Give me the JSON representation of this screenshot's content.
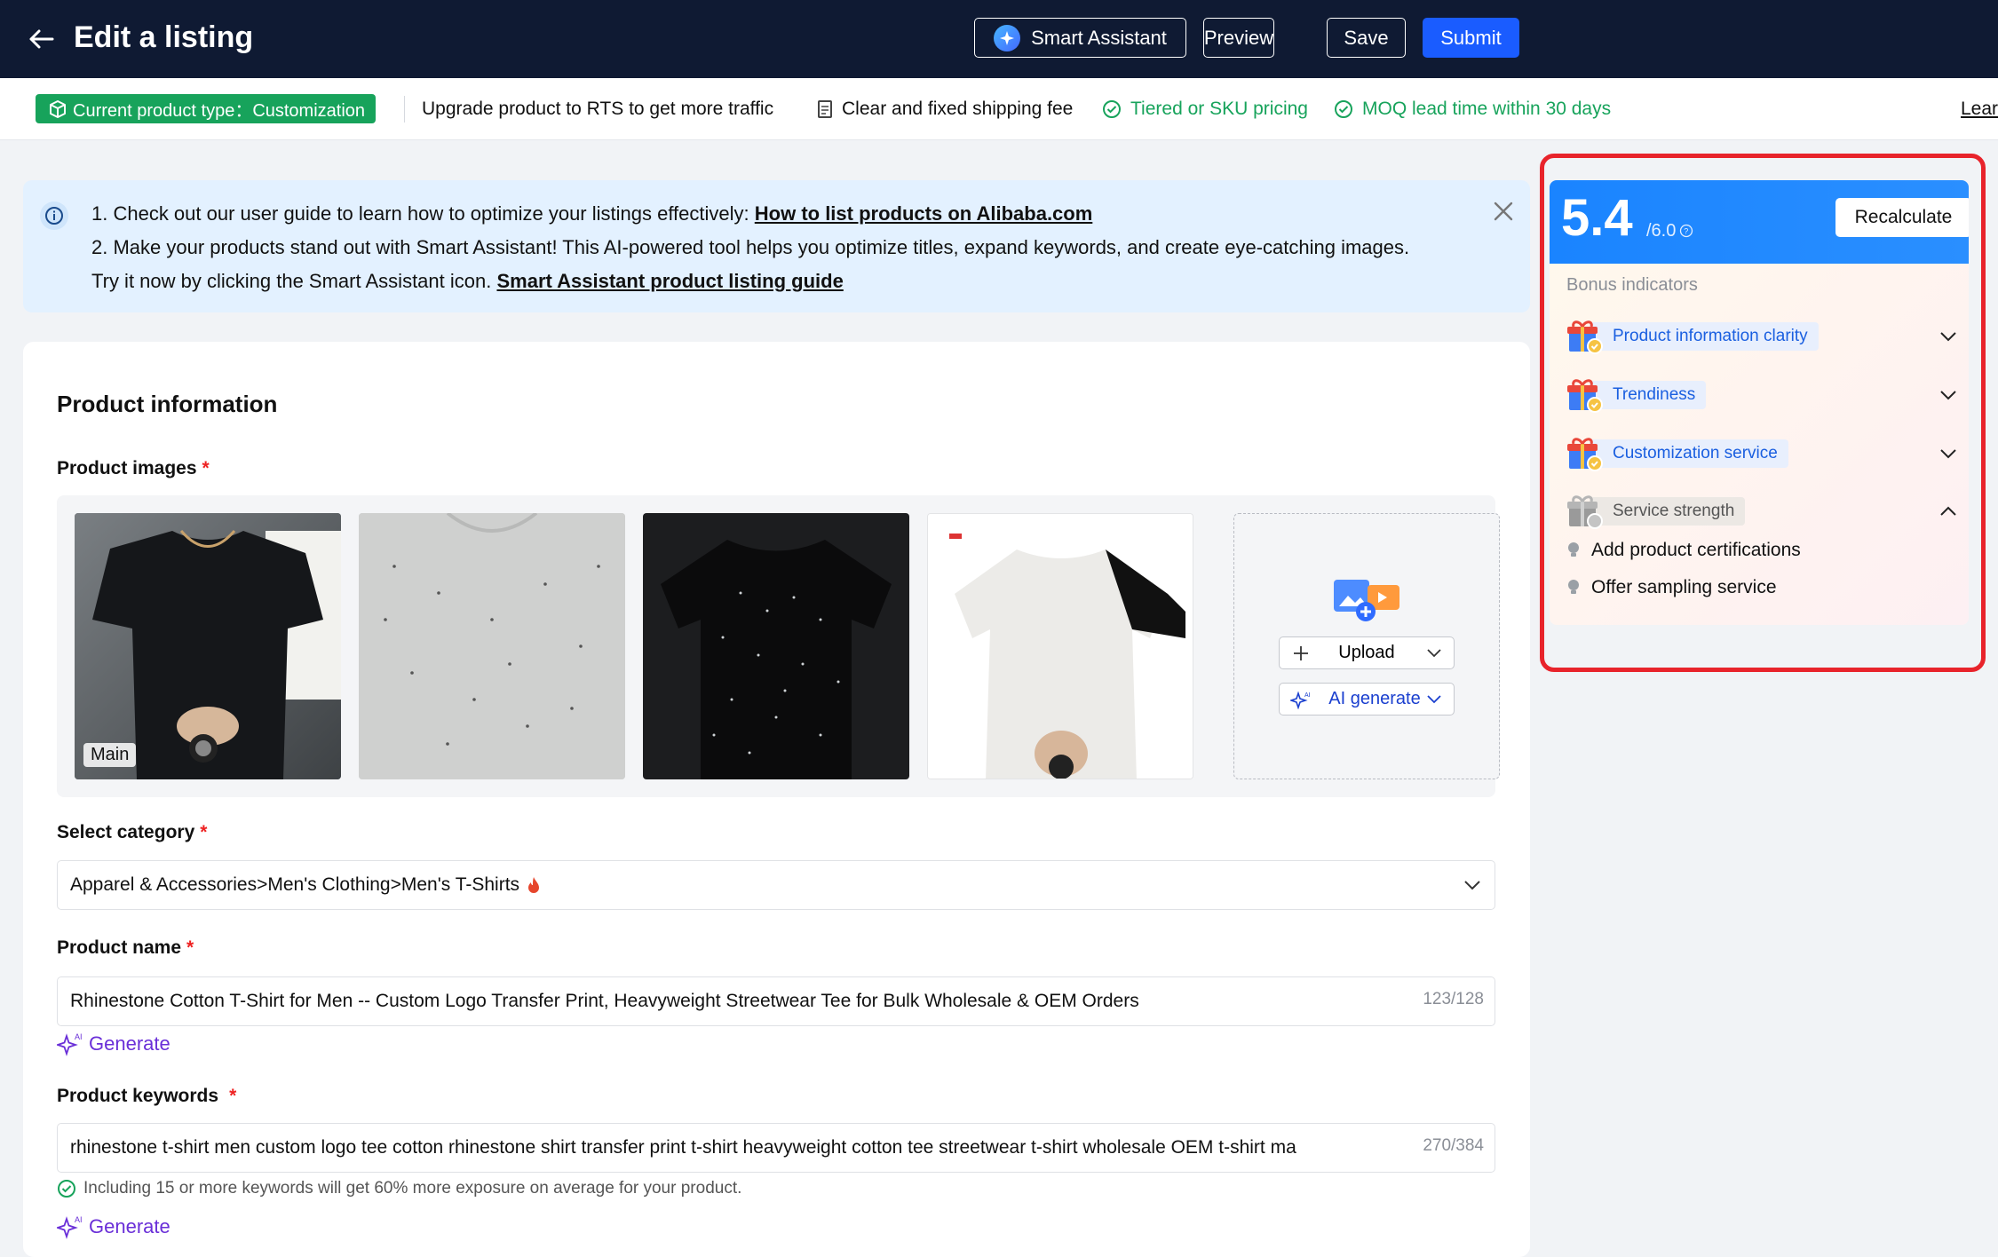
{
  "header": {
    "title": "Edit a listing",
    "smart_assistant": "Smart Assistant",
    "preview": "Preview",
    "save": "Save",
    "submit": "Submit"
  },
  "info_bar": {
    "product_type": "Current product type：Customization",
    "upgrade": "Upgrade product to RTS to get more traffic",
    "shipping": "Clear and fixed shipping fee",
    "tiered": "Tiered or SKU pricing",
    "moq": "MOQ lead time within 30 days",
    "learn": "Lear"
  },
  "notice": {
    "line1_text": "1. Check out our user guide to learn how to optimize your listings effectively: ",
    "line1_link": "How to list products on Alibaba.com",
    "line2": "2. Make your products stand out with Smart Assistant! This AI-powered tool helps you optimize titles, expand keywords, and create eye-catching images.",
    "line3_text": "Try it now by clicking the Smart Assistant icon. ",
    "line3_link": "Smart Assistant product listing guide"
  },
  "form": {
    "section_title": "Product information",
    "images_label": "Product images",
    "main_label": "Main",
    "upload_label": "Upload",
    "ai_generate_label": "AI generate",
    "category_label": "Select category",
    "category_value": "Apparel & Accessories>Men's Clothing>Men's T-Shirts",
    "name_label": "Product name",
    "name_value": "Rhinestone Cotton T-Shirt for Men -- Custom Logo Transfer Print, Heavyweight Streetwear Tee for Bulk Wholesale & OEM Orders",
    "name_counter": "123/128",
    "generate_label": "Generate",
    "keywords_label": "Product keywords",
    "keywords_value": "rhinestone t-shirt men custom logo tee cotton rhinestone shirt transfer print t-shirt heavyweight cotton tee streetwear t-shirt wholesale OEM t-shirt ma",
    "keywords_counter": "270/384",
    "keywords_hint": "Including 15 or more keywords will get 60% more exposure on average for your product.",
    "generate_label_2": "Generate",
    "required_mark": "*"
  },
  "score": {
    "value": "5.4",
    "max": "/6.0",
    "recalculate": "Recalculate",
    "bonus_title": "Bonus indicators",
    "indicators": [
      {
        "label": "Product information clarity",
        "state": "achieved"
      },
      {
        "label": "Trendiness",
        "state": "achieved"
      },
      {
        "label": "Customization service",
        "state": "achieved"
      },
      {
        "label": "Service strength",
        "state": "pending"
      }
    ],
    "sub_items": [
      "Add product certifications",
      "Offer sampling service"
    ]
  },
  "colors": {
    "header_bg": "#0f1a33",
    "accent_blue": "#1a5cff",
    "success_green": "#17a35b",
    "highlight_red": "#e8232b",
    "ai_purple": "#6a2fd8"
  }
}
